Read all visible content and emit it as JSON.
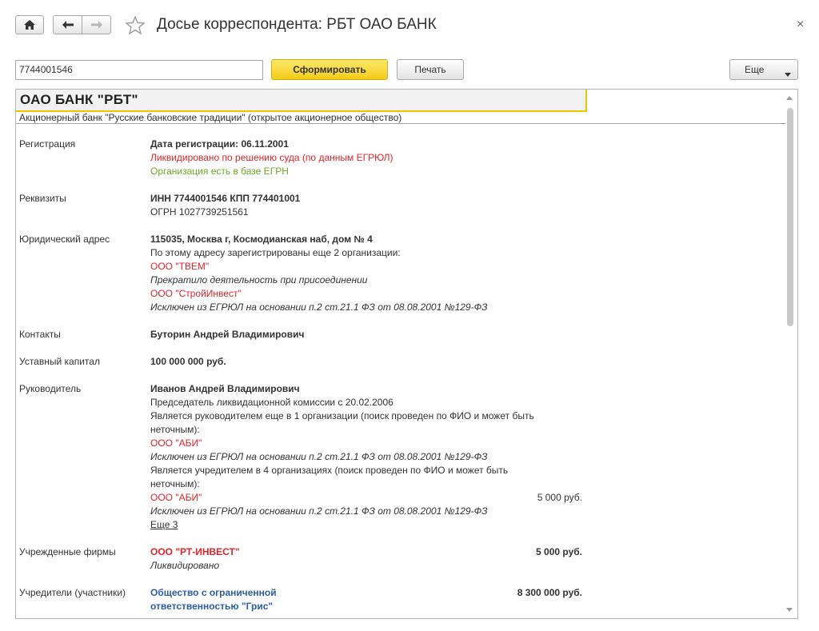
{
  "window": {
    "title": "Досье корреспондента: РБТ ОАО БАНК",
    "close_glyph": "×",
    "home_icon": "home-icon",
    "back_icon": "arrow-left-icon",
    "forward_icon": "arrow-right-icon",
    "favorite_icon": "star-icon"
  },
  "toolbar": {
    "search_value": "7744001546",
    "generate_label": "Сформировать",
    "print_label": "Печать",
    "more_label": "Еще"
  },
  "org": {
    "short_name": "ОАО БАНК \"РБТ\"",
    "full_name": "Акционерный банк \"Русские банковские традиции\" (открытое акционерное общество)"
  },
  "registration": {
    "label": "Регистрация",
    "date": "Дата регистрации: 06.11.2001",
    "liquidated": "Ликвидировано по решению суда (по данным ЕГРЮЛ)",
    "egrn": "Организация есть в базе ЕГРН"
  },
  "requisites": {
    "label": "Реквизиты",
    "inn_kpp": "ИНН 7744001546 КПП 774401001",
    "ogrn": "ОГРН 1027739251561"
  },
  "address": {
    "label": "Юридический адрес",
    "value": "115035, Москва г, Космодианская наб, дом № 4",
    "also": "По этому адресу зарегистрированы еще 2 организации:",
    "org1": "ООО \"ТВЕМ\"",
    "org1_note": "Прекратило деятельность при присоединении",
    "org2": "ООО \"СтройИнвест\"",
    "org2_note": "Исключен из ЕГРЮЛ на основании п.2 ст.21.1 ФЗ от 08.08.2001 №129-ФЗ"
  },
  "contacts": {
    "label": "Контакты",
    "value": "Буторин Андрей Владимирович"
  },
  "capital": {
    "label": "Уставный капитал",
    "value": "100 000 000 руб."
  },
  "head": {
    "label": "Руководитель",
    "name": "Иванов Андрей Владимирович",
    "position": "Председатель ликвидационной комиссии с 20.02.2006",
    "head_note_1": "Является руководителем еще в 1 организации (поиск проведен по ФИО и может быть",
    "head_note_2": "неточным):",
    "head_org": "ООО \"АБИ\"",
    "head_org_note": "Исключен из ЕГРЮЛ на основании п.2 ст.21.1 ФЗ от 08.08.2001 №129-ФЗ",
    "founder_note_1": "Является учредителем в 4 организациях (поиск проведен по ФИО и может быть",
    "founder_note_2": "неточным):",
    "founder_org": "ООО \"АБИ\"",
    "founder_amount": "5 000 руб.",
    "founder_org_note": "Исключен из ЕГРЮЛ на основании п.2 ст.21.1 ФЗ от 08.08.2001 №129-ФЗ",
    "more_link": "Еще 3"
  },
  "founded": {
    "label": "Учрежденные фирмы",
    "org": "ООО \"РТ-ИНВЕСТ\"",
    "amount": "5 000 руб.",
    "status": "Ликвидировано"
  },
  "founders": {
    "label": "Учредители (участники)",
    "org_line1": "Общество с ограниченной",
    "org_line2": "ответственностью \"Грис\"",
    "amount": "8 300 000 руб."
  }
}
